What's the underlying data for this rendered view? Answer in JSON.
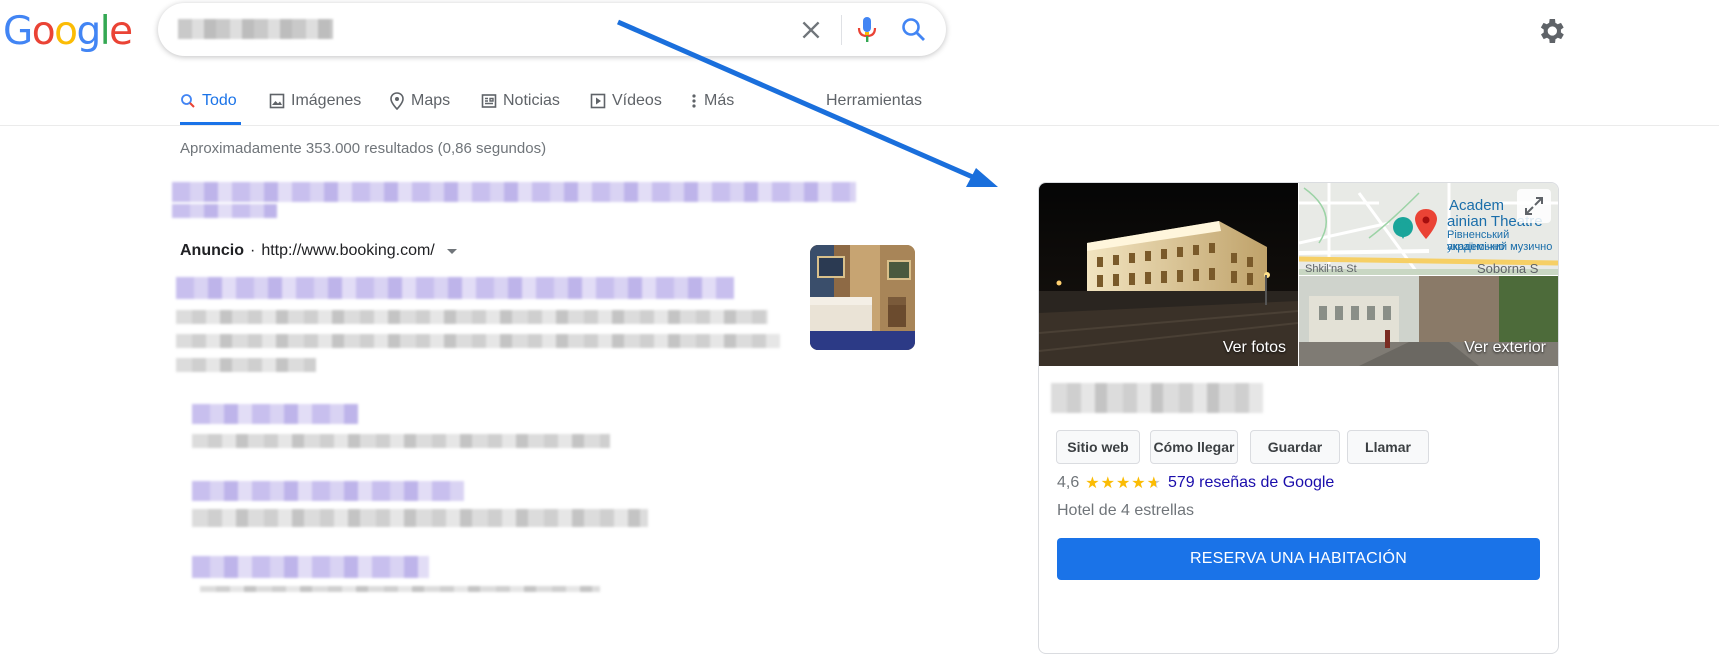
{
  "logo": {
    "letters": [
      "G",
      "o",
      "o",
      "g",
      "l",
      "e"
    ]
  },
  "search": {
    "query": ""
  },
  "tabs": [
    {
      "label": "Todo",
      "icon": "search-icon",
      "active": true
    },
    {
      "label": "Imágenes",
      "icon": "image-icon"
    },
    {
      "label": "Maps",
      "icon": "map-pin-icon"
    },
    {
      "label": "Noticias",
      "icon": "news-icon"
    },
    {
      "label": "Vídeos",
      "icon": "play-icon"
    },
    {
      "label": "Más",
      "icon": "more-vert-icon"
    },
    {
      "label": "Herramientas"
    }
  ],
  "result_stats": "Aproximadamente 353.000 resultados (0,86 segundos)",
  "ad": {
    "label": "Anuncio",
    "separator": "·",
    "url": "http://www.booking.com/"
  },
  "knowledge_panel": {
    "photos_label": "Ver fotos",
    "exterior_label": "Ver exterior",
    "map_labels": {
      "academ": "Academ",
      "theatre": "ainian Theatre",
      "ukr1": "Рівненський академічно",
      "ukr2": "український музично",
      "street1": "Shkil'na St",
      "street2": "Soborna S"
    },
    "buttons": [
      "Sitio web",
      "Cómo llegar",
      "Guardar",
      "Llamar"
    ],
    "rating": "4,6",
    "stars_text": "★★★★",
    "star_rating": 4.6,
    "reviews": "579 reseñas de Google",
    "hotel_type": "Hotel de 4 estrellas",
    "cta": "RESERVA UNA HABITACIÓN"
  },
  "colors": {
    "accent": "#1a73e8",
    "link": "#1a0dab",
    "arrow": "#1a6fdc"
  }
}
